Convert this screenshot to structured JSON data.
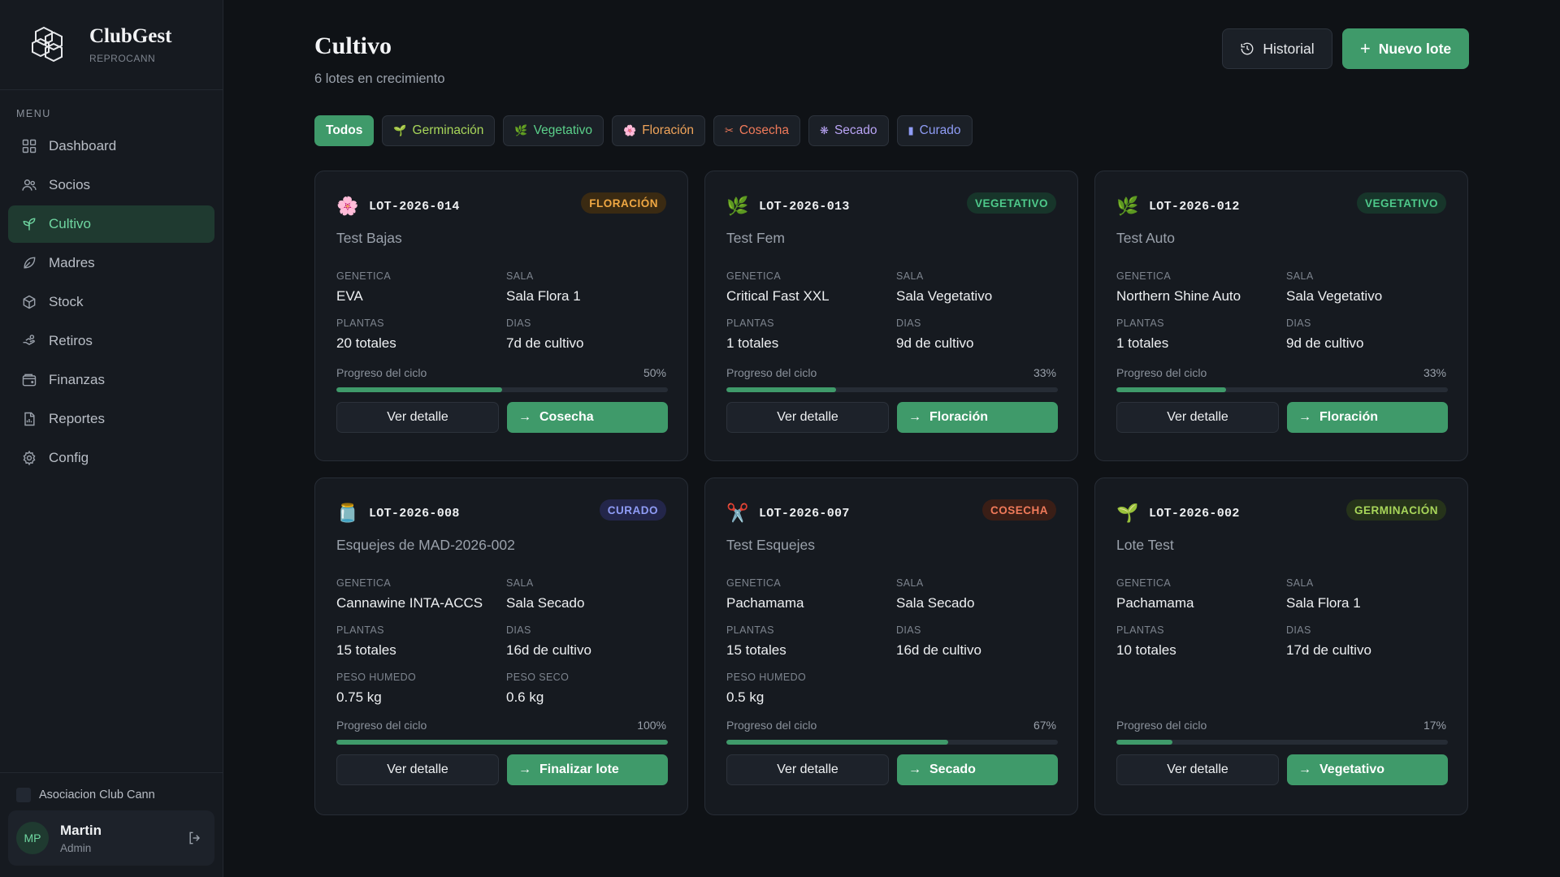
{
  "brand": {
    "name": "ClubGest",
    "sub": "REPROCANN"
  },
  "menu_label": "MENU",
  "nav": [
    {
      "label": "Dashboard",
      "icon": "grid-icon",
      "active": false
    },
    {
      "label": "Socios",
      "icon": "users-icon",
      "active": false
    },
    {
      "label": "Cultivo",
      "icon": "sprout-icon",
      "active": true
    },
    {
      "label": "Madres",
      "icon": "leaf-icon",
      "active": false
    },
    {
      "label": "Stock",
      "icon": "box-icon",
      "active": false
    },
    {
      "label": "Retiros",
      "icon": "hand-icon",
      "active": false
    },
    {
      "label": "Finanzas",
      "icon": "wallet-icon",
      "active": false
    },
    {
      "label": "Reportes",
      "icon": "report-icon",
      "active": false
    },
    {
      "label": "Config",
      "icon": "gear-icon",
      "active": false
    }
  ],
  "org": "Asociacion Club Cann",
  "user": {
    "initials": "MP",
    "name": "Martin",
    "role": "Admin"
  },
  "header": {
    "title": "Cultivo",
    "subtitle": "6 lotes en crecimiento",
    "history_label": "Historial",
    "new_label": "Nuevo lote"
  },
  "filters": [
    {
      "label": "Todos",
      "glyph": "",
      "color": "#ffffff",
      "active": true
    },
    {
      "label": "Germinación",
      "glyph": "🌱",
      "color": "#a8d65a",
      "active": false
    },
    {
      "label": "Vegetativo",
      "glyph": "🌿",
      "color": "#5bd08a",
      "active": false
    },
    {
      "label": "Floración",
      "glyph": "🌸",
      "color": "#f0a45a",
      "active": false
    },
    {
      "label": "Cosecha",
      "glyph": "✂",
      "color": "#f07a5a",
      "active": false
    },
    {
      "label": "Secado",
      "glyph": "❋",
      "color": "#b9a4f5",
      "active": false
    },
    {
      "label": "Curado",
      "glyph": "▮",
      "color": "#8f9cf5",
      "active": false
    }
  ],
  "labels": {
    "genetica": "GENETICA",
    "sala": "SALA",
    "plantas": "PLANTAS",
    "dias": "DIAS",
    "peso_humedo": "PESO HUMEDO",
    "peso_seco": "PESO SECO",
    "progress": "Progreso del ciclo",
    "detail": "Ver detalle"
  },
  "lots": [
    {
      "id": "LOT-2026-014",
      "name": "Test Bajas",
      "icon": "flower-icon",
      "glyph": "🌸",
      "stage": "FLORACIÓN",
      "stage_color": "#f0a843",
      "stage_bg": "#3a2a12",
      "genetica": "EVA",
      "sala": "Sala Flora 1",
      "plantas": "20 totales",
      "dias": "7d de cultivo",
      "progress_text": "50%",
      "progress": 0.5,
      "next": "Cosecha"
    },
    {
      "id": "LOT-2026-013",
      "name": "Test Fem",
      "icon": "herb-icon",
      "glyph": "🌿",
      "stage": "VEGETATIVO",
      "stage_color": "#4ec98a",
      "stage_bg": "#17352a",
      "genetica": "Critical Fast XXL",
      "sala": "Sala Vegetativo",
      "plantas": "1 totales",
      "dias": "9d de cultivo",
      "progress_text": "33%",
      "progress": 0.33,
      "next": "Floración"
    },
    {
      "id": "LOT-2026-012",
      "name": "Test Auto",
      "icon": "herb-icon",
      "glyph": "🌿",
      "stage": "VEGETATIVO",
      "stage_color": "#4ec98a",
      "stage_bg": "#17352a",
      "genetica": "Northern Shine Auto",
      "sala": "Sala Vegetativo",
      "plantas": "1 totales",
      "dias": "9d de cultivo",
      "progress_text": "33%",
      "progress": 0.33,
      "next": "Floración"
    },
    {
      "id": "LOT-2026-008",
      "name": "Esquejes de MAD-2026-002",
      "icon": "jar-icon",
      "glyph": "🫙",
      "stage": "CURADO",
      "stage_color": "#8f9cf5",
      "stage_bg": "#23264a",
      "genetica": "Cannawine INTA-ACCS",
      "sala": "Sala Secado",
      "plantas": "15 totales",
      "dias": "16d de cultivo",
      "peso_humedo": "0.75 kg",
      "peso_seco": "0.6 kg",
      "progress_text": "100%",
      "progress": 1.0,
      "next": "Finalizar lote"
    },
    {
      "id": "LOT-2026-007",
      "name": "Test Esquejes",
      "icon": "scissors-icon",
      "glyph": "✂️",
      "stage": "COSECHA",
      "stage_color": "#f07a5a",
      "stage_bg": "#3a1e16",
      "genetica": "Pachamama",
      "sala": "Sala Secado",
      "plantas": "15 totales",
      "dias": "16d de cultivo",
      "peso_humedo": "0.5 kg",
      "progress_text": "67%",
      "progress": 0.67,
      "next": "Secado"
    },
    {
      "id": "LOT-2026-002",
      "name": "Lote Test",
      "icon": "seedling-icon",
      "glyph": "🌱",
      "stage": "GERMINACIÓN",
      "stage_color": "#a8d65a",
      "stage_bg": "#26331a",
      "genetica": "Pachamama",
      "sala": "Sala Flora 1",
      "plantas": "10 totales",
      "dias": "17d de cultivo",
      "progress_text": "17%",
      "progress": 0.17,
      "next": "Vegetativo"
    }
  ]
}
